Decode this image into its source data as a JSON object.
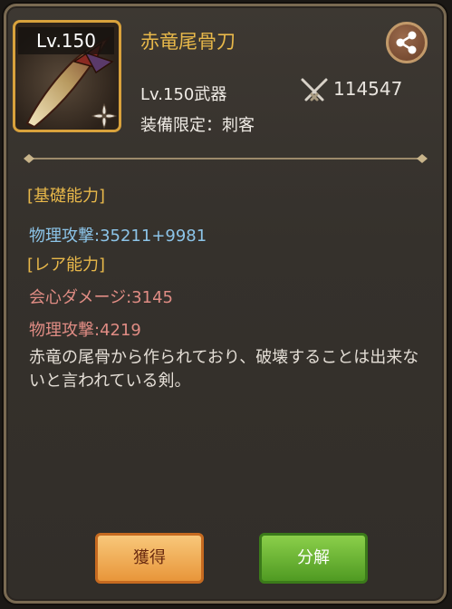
{
  "item": {
    "level_badge": "Lv.150",
    "name": "赤竜尾骨刀",
    "type_line": "Lv.150武器",
    "restriction": "装備限定：刺客",
    "power": "114547",
    "icon": "curved-blade-weapon",
    "class_icon": "shuriken-icon"
  },
  "sections": {
    "basic_title": "[基礎能力]",
    "basic_stat": "物理攻撃:35211+9981",
    "rare_title": "[レア能力]",
    "rare_stat_1": "会心ダメージ:3145",
    "rare_stat_2": "物理攻撃:4219"
  },
  "description": "赤竜の尾骨から作られており、破壊することは出来ないと言われている剣。",
  "buttons": {
    "obtain": "獲得",
    "dismantle": "分解"
  },
  "colors": {
    "title_gold": "#e8b84a",
    "basic_stat_blue": "#8cc4e8",
    "rare_stat_red": "#e08c84"
  }
}
